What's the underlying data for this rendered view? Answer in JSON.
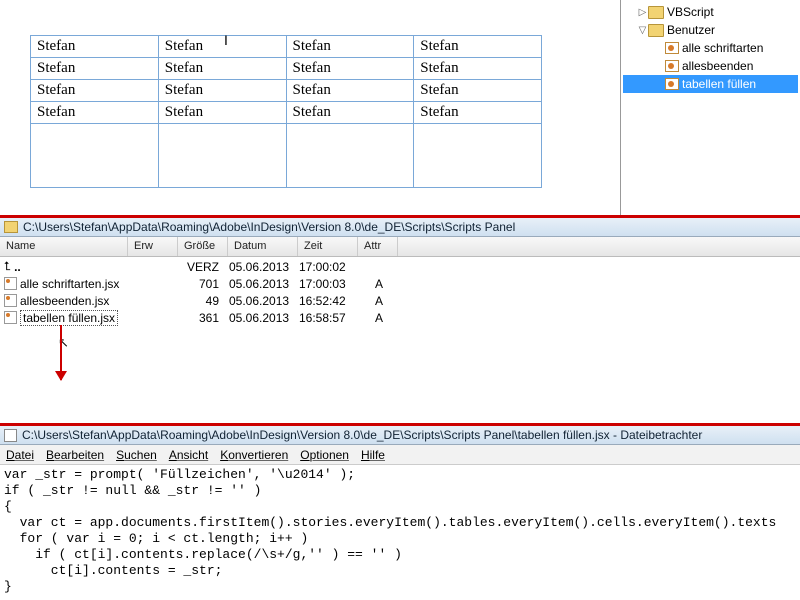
{
  "doc": {
    "cell": "Stefan"
  },
  "tree": {
    "vbscript": "VBScript",
    "benutzer": "Benutzer",
    "s1": "alle schriftarten",
    "s2": "allesbeenden",
    "s3": "tabellen füllen"
  },
  "mid": {
    "path": "C:\\Users\\Stefan\\AppData\\Roaming\\Adobe\\InDesign\\Version 8.0\\de_DE\\Scripts\\Scripts Panel",
    "cols": {
      "name": "Name",
      "erw": "Erw",
      "size": "Größe",
      "date": "Datum",
      "time": "Zeit",
      "attr": "Attr"
    },
    "rows": [
      {
        "name": "..",
        "erw": "",
        "size": "VERZ",
        "date": "05.06.2013",
        "time": "17:00:02",
        "attr": ""
      },
      {
        "name": "alle schriftarten.jsx",
        "erw": "",
        "size": "701",
        "date": "05.06.2013",
        "time": "17:00:03",
        "attr": "A"
      },
      {
        "name": "allesbeenden.jsx",
        "erw": "",
        "size": "49",
        "date": "05.06.2013",
        "time": "16:52:42",
        "attr": "A"
      },
      {
        "name": "tabellen füllen.jsx",
        "erw": "",
        "size": "361",
        "date": "05.06.2013",
        "time": "16:58:57",
        "attr": "A"
      }
    ]
  },
  "bot": {
    "path": "C:\\Users\\Stefan\\AppData\\Roaming\\Adobe\\InDesign\\Version 8.0\\de_DE\\Scripts\\Scripts Panel\\tabellen füllen.jsx - Dateibetrachter",
    "menu": {
      "datei": "Datei",
      "bearbeiten": "Bearbeiten",
      "suchen": "Suchen",
      "ansicht": "Ansicht",
      "konvertieren": "Konvertieren",
      "optionen": "Optionen",
      "hilfe": "Hilfe"
    },
    "code": "var _str = prompt( 'Füllzeichen', '\\u2014' );\nif ( _str != null && _str != '' )\n{\n  var ct = app.documents.firstItem().stories.everyItem().tables.everyItem().cells.everyItem().texts\n  for ( var i = 0; i < ct.length; i++ )\n    if ( ct[i].contents.replace(/\\s+/g,'' ) == '' )\n      ct[i].contents = _str;\n}"
  }
}
